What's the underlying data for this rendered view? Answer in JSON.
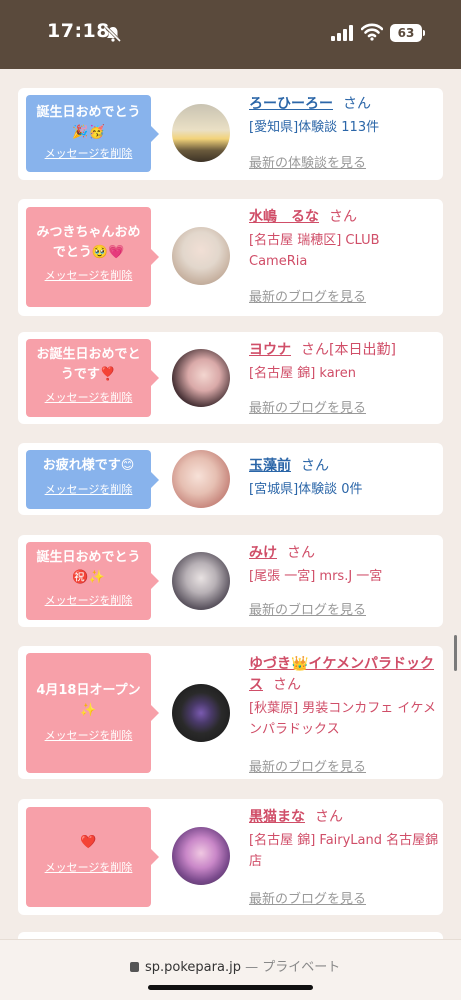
{
  "status_bar": {
    "time": "17:18",
    "battery": "63",
    "icons": [
      "bell-slash-icon",
      "cellular-signal-icon",
      "wifi-icon",
      "battery-icon"
    ]
  },
  "url_bar": {
    "domain": "sp.pokepara.jp",
    "separator": " — ",
    "privacy": "プライベート"
  },
  "colors": {
    "status_bg": "#5a4a3c",
    "page_bg": "#f3ece7",
    "bubble_blue": "#88b3ec",
    "bubble_pink": "#f7a0a9",
    "link_blue": "#2b66a8",
    "link_pink": "#d04e68"
  },
  "delete_label": "メッセージを削除",
  "cards": [
    {
      "message": "誕生日おめでとう🎉🥳",
      "name": "ろーひーろー",
      "honorific": "さん",
      "detail": "[愛知県]体験談 113件",
      "latest": "最新の体験談を見る"
    },
    {
      "message": "みつきちゃんおめでとう🥹💗",
      "name": "水嶋　るな",
      "honorific": "さん",
      "detail": "[名古屋 瑞穂区] CLUB CameRia",
      "latest": "最新のブログを見る"
    },
    {
      "message": "お誕生日おめでとうです❣️",
      "name": "ヨウナ",
      "honorific": "さん[本日出勤]",
      "detail": "[名古屋 錦] karen",
      "latest": "最新のブログを見る"
    },
    {
      "message": "お疲れ様です😊",
      "name": "玉藻前",
      "honorific": "さん",
      "detail": "[宮城県]体験談 0件",
      "latest": ""
    },
    {
      "message": "誕生日おめでとう㊗️✨",
      "name": "みけ",
      "honorific": "さん",
      "detail": "[尾張 一宮] mrs.J 一宮",
      "latest": "最新のブログを見る"
    },
    {
      "message": "4月18日オープン✨",
      "name": "ゆづき👑イケメンパラドックス",
      "honorific": "さん",
      "detail": "[秋葉原] 男装コンカフェ イケメンパラドックス",
      "latest": "最新のブログを見る"
    },
    {
      "message": "❤️",
      "name": "黒猫まな",
      "honorific": "さん",
      "detail": "[名古屋 錦] FairyLand 名古屋錦店",
      "latest": "最新のブログを見る"
    }
  ]
}
